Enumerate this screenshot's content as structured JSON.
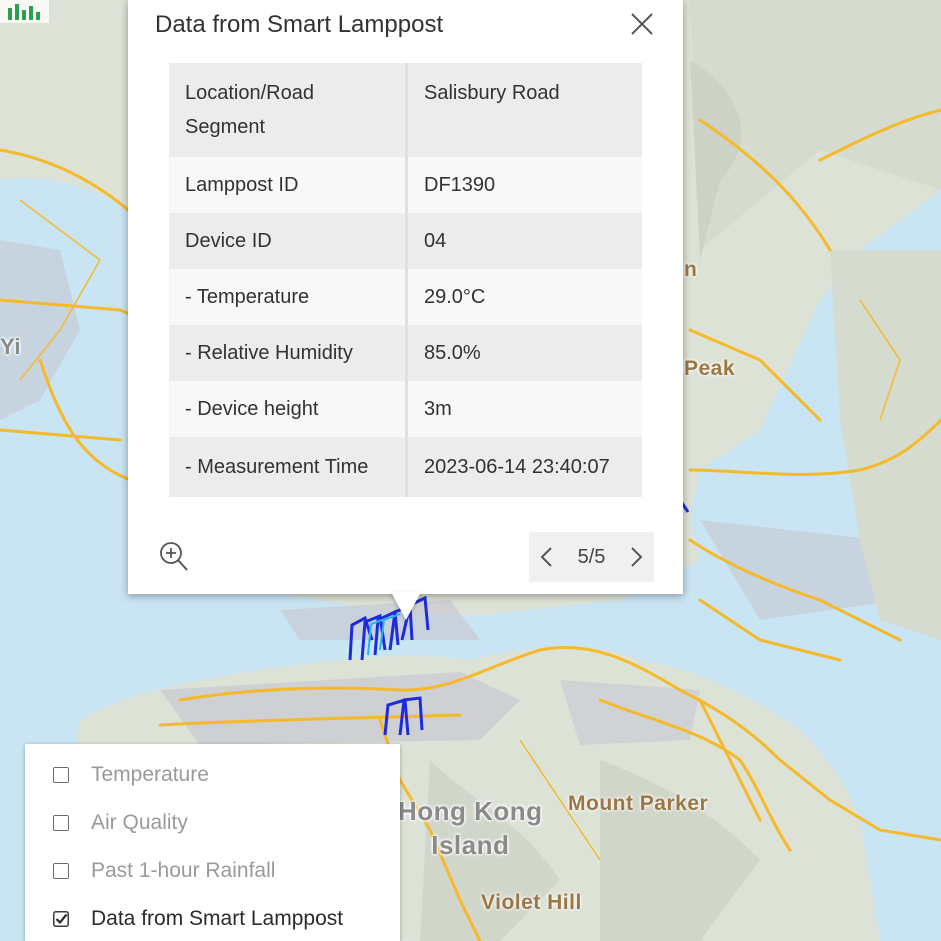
{
  "map": {
    "labels": {
      "yi": "Yi",
      "lantau_n": "n",
      "peak": "Peak",
      "hong_kong_island": "Hong Kong\nIsland",
      "mount_parker": "Mount Parker",
      "violet_hill": "Violet Hill"
    },
    "colors": {
      "water": "#c9e4f2",
      "land": "#dde2d6",
      "road": "#f5b92a",
      "urban": "#c7c9d3",
      "sensor": "#1d2ae0"
    }
  },
  "popup": {
    "title": "Data from Smart Lamppost",
    "close_icon": "close-icon",
    "rows": [
      {
        "label": "Location/Road Segment",
        "value": "Salisbury Road"
      },
      {
        "label": "Lamppost ID",
        "value": "DF1390"
      },
      {
        "label": "Device ID",
        "value": "04"
      },
      {
        "label": "- Temperature",
        "value": "29.0°C"
      },
      {
        "label": "- Relative Humidity",
        "value": "85.0%"
      },
      {
        "label": "- Device height",
        "value": "3m"
      },
      {
        "label": "- Measurement Time",
        "value": "2023-06-14 23:40:07"
      }
    ],
    "zoom_icon": "zoom-in-icon",
    "pager": {
      "prev_icon": "chevron-left-icon",
      "text": "5/5",
      "next_icon": "chevron-right-icon"
    }
  },
  "layers": [
    {
      "label": "Temperature",
      "checked": false
    },
    {
      "label": "Air Quality",
      "checked": false
    },
    {
      "label": "Past 1-hour Rainfall",
      "checked": false
    },
    {
      "label": "Data from Smart Lamppost",
      "checked": true
    }
  ]
}
